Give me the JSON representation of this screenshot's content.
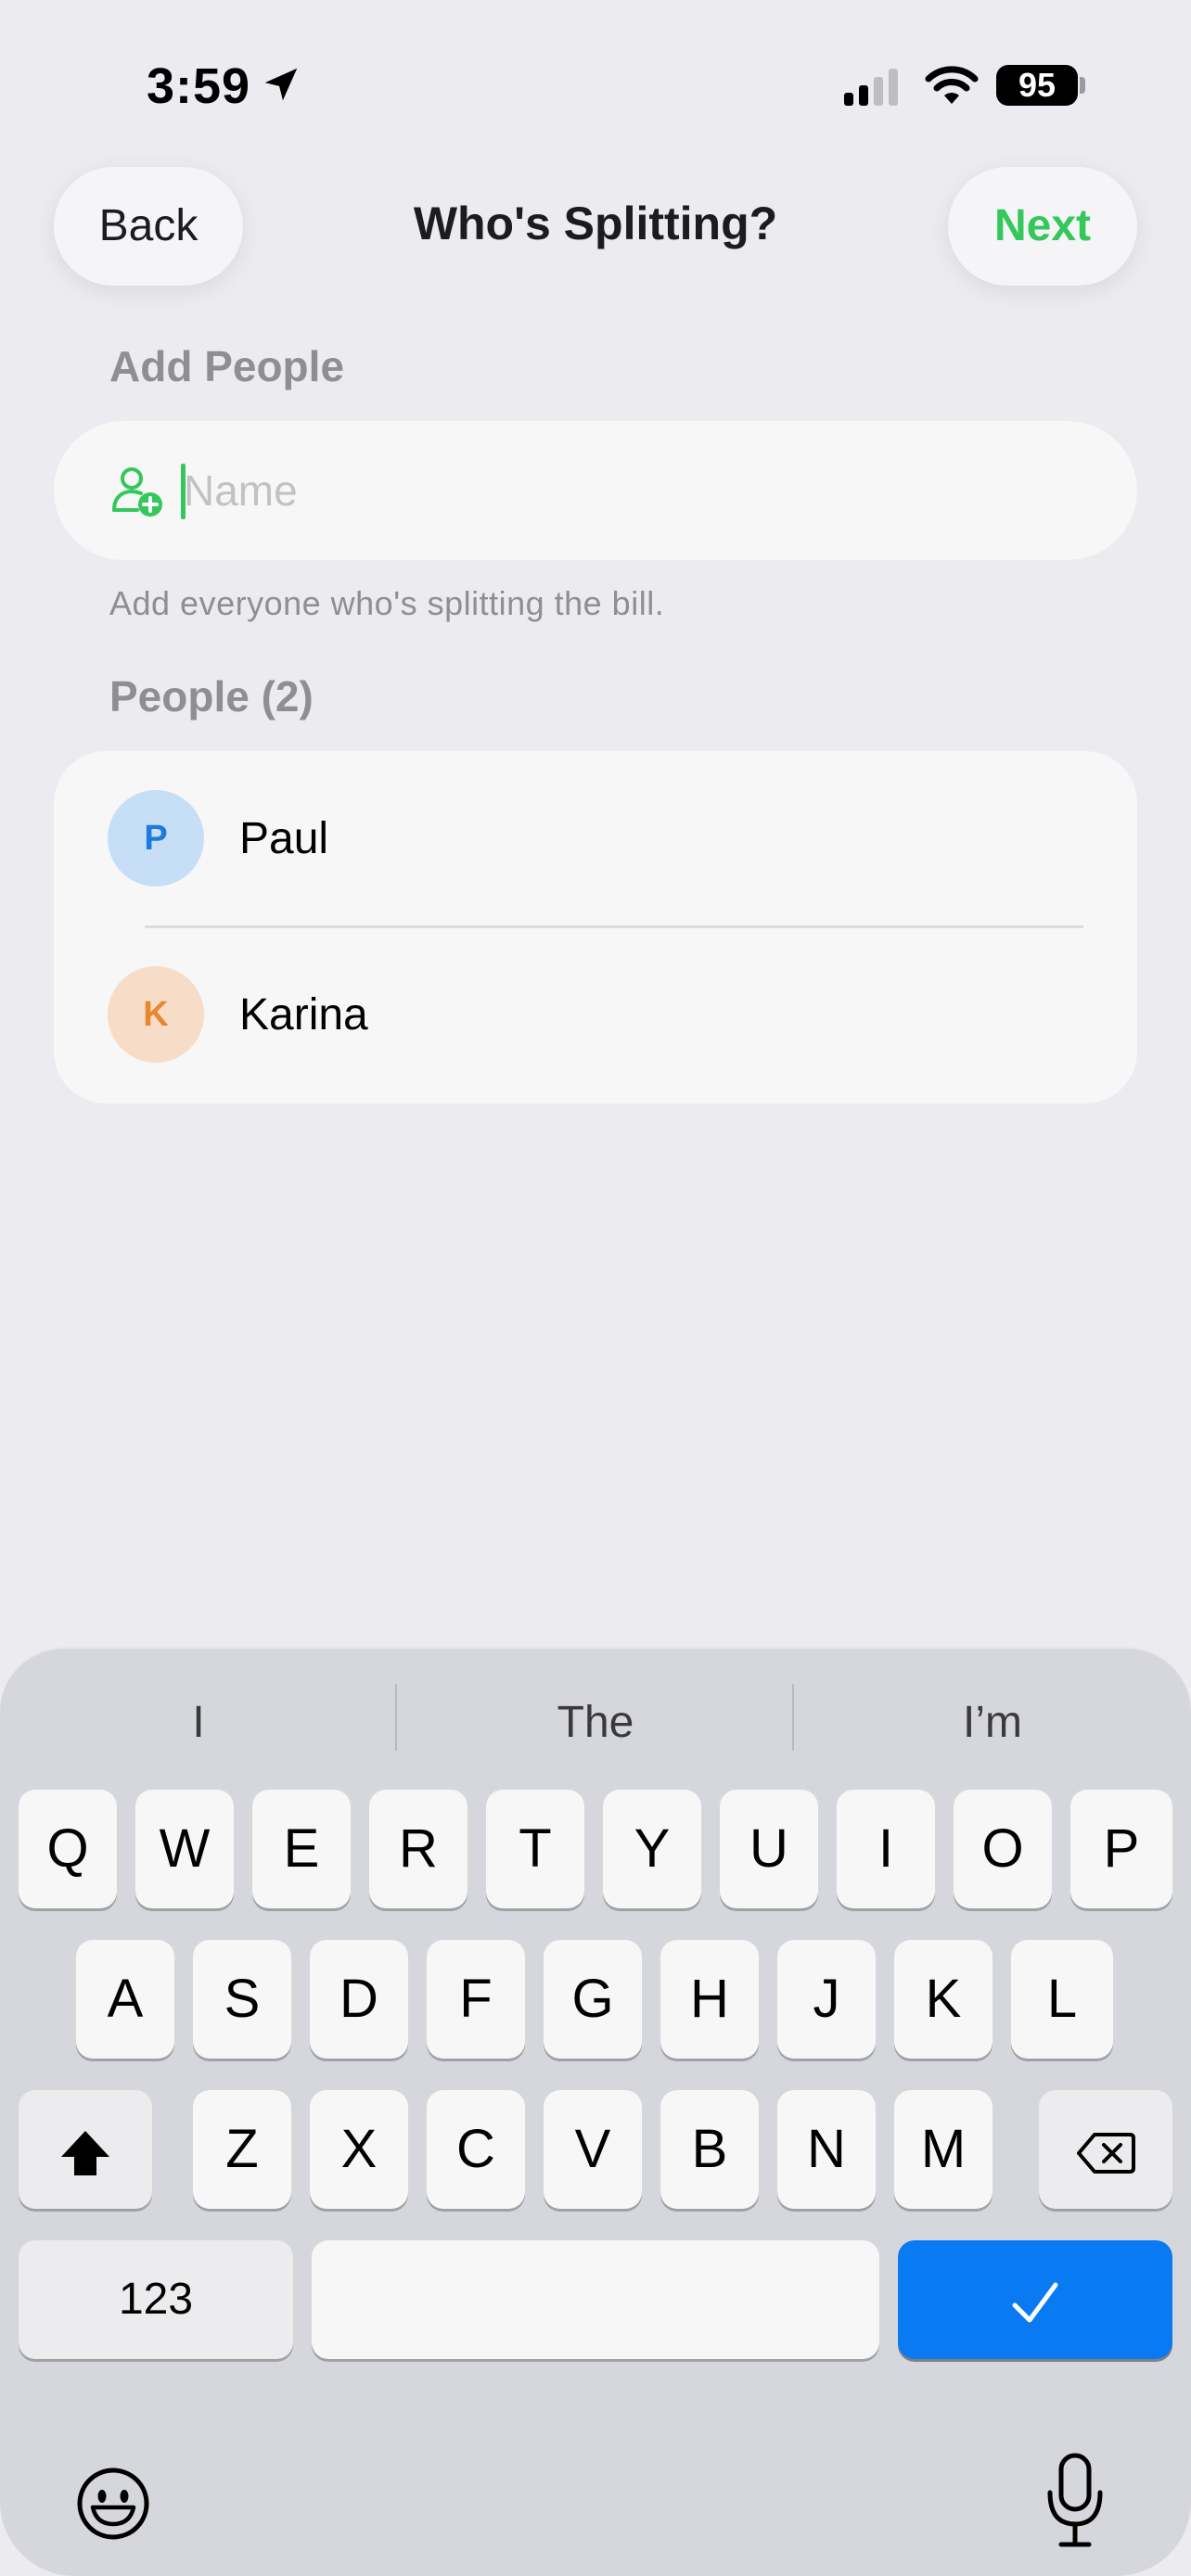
{
  "status_bar": {
    "time": "3:59",
    "battery": "95",
    "location_icon": "location-arrow-icon",
    "signal_icon": "cellular-signal-icon",
    "wifi_icon": "wifi-icon"
  },
  "nav": {
    "back_label": "Back",
    "title": "Who's Splitting?",
    "next_label": "Next"
  },
  "add_section": {
    "header": "Add People",
    "input_placeholder": "Name",
    "input_value": "",
    "helper": "Add everyone who's splitting the bill.",
    "icon": "person-add-icon"
  },
  "people_section": {
    "header": "People (2)",
    "people": [
      {
        "initial": "P",
        "name": "Paul",
        "avatar_bg": "#C6DEF6",
        "avatar_fg": "#1E7BD9"
      },
      {
        "initial": "K",
        "name": "Karina",
        "avatar_bg": "#F7DCC7",
        "avatar_fg": "#E8872E"
      }
    ]
  },
  "keyboard": {
    "suggestions": [
      "I",
      "The",
      "I’m"
    ],
    "row1": [
      "Q",
      "W",
      "E",
      "R",
      "T",
      "Y",
      "U",
      "I",
      "O",
      "P"
    ],
    "row2": [
      "A",
      "S",
      "D",
      "F",
      "G",
      "H",
      "J",
      "K",
      "L"
    ],
    "row3": [
      "Z",
      "X",
      "C",
      "V",
      "B",
      "N",
      "M"
    ],
    "numbers_label": "123",
    "shift_icon": "shift-icon",
    "delete_icon": "backspace-icon",
    "return_icon": "checkmark-icon",
    "emoji_icon": "emoji-icon",
    "mic_icon": "microphone-icon"
  },
  "colors": {
    "accent": "#34C759",
    "return_key": "#0A7AF2",
    "background": "#EBEBF0"
  }
}
